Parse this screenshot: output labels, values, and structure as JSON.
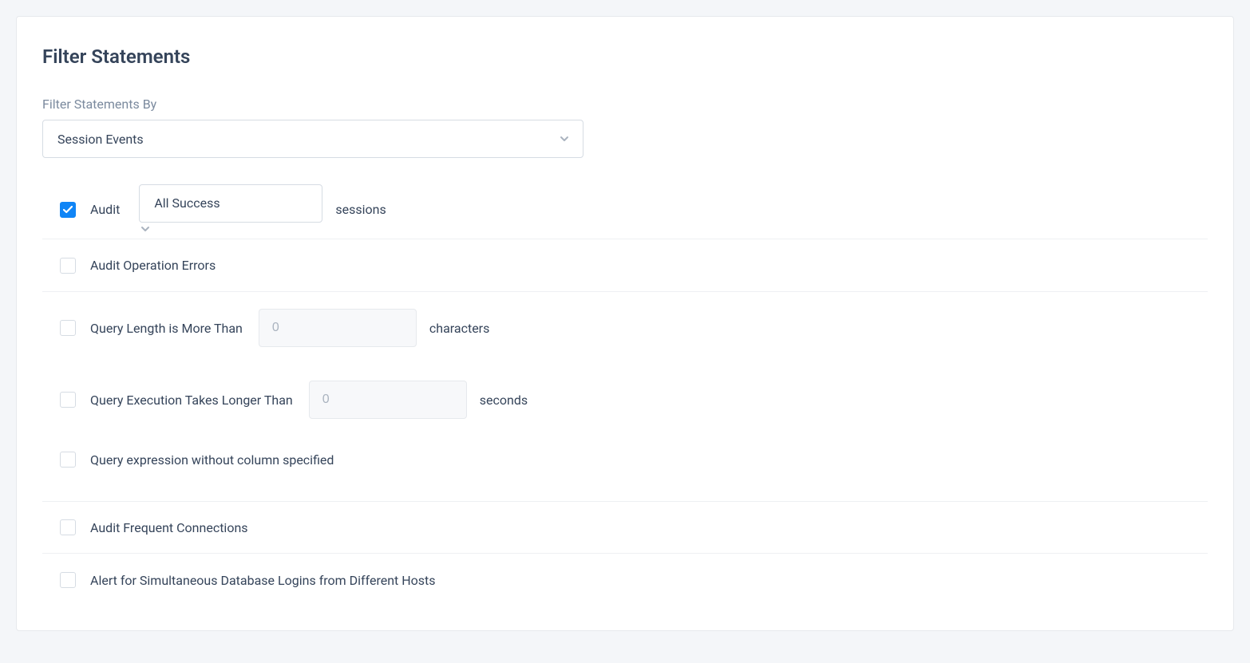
{
  "page": {
    "title": "Filter Statements",
    "filterByLabel": "Filter Statements By",
    "filterByValue": "Session Events"
  },
  "rows": {
    "audit": {
      "label": "Audit",
      "checked": true,
      "selectValue": "All Success",
      "suffix": "sessions"
    },
    "auditOperationErrors": {
      "label": "Audit Operation Errors",
      "checked": false
    },
    "queryLength": {
      "label": "Query Length is More Than",
      "checked": false,
      "inputPlaceholder": "0",
      "inputValue": "",
      "suffix": "characters"
    },
    "queryExecTime": {
      "label": "Query Execution Takes Longer Than",
      "checked": false,
      "inputPlaceholder": "0",
      "inputValue": "",
      "suffix": "seconds"
    },
    "queryNoColumn": {
      "label": "Query expression without column specified",
      "checked": false
    },
    "auditFrequentConn": {
      "label": "Audit Frequent Connections",
      "checked": false
    },
    "alertSimulLogins": {
      "label": "Alert for Simultaneous Database Logins from Different Hosts",
      "checked": false
    }
  }
}
